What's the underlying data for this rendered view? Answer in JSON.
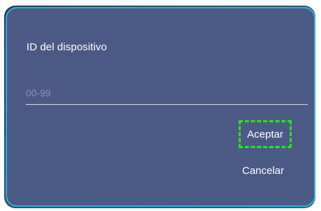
{
  "dialog": {
    "title": "ID del dispositivo",
    "input": {
      "value": "",
      "placeholder": "00-99"
    },
    "buttons": {
      "accept_label": "Aceptar",
      "cancel_label": "Cancelar"
    }
  },
  "colors": {
    "dialog_background": "#4a5a85",
    "dialog_border": "#2ab0e6",
    "focus_highlight": "#27e61e",
    "text": "#ffffff",
    "placeholder": "#8a93b8"
  }
}
